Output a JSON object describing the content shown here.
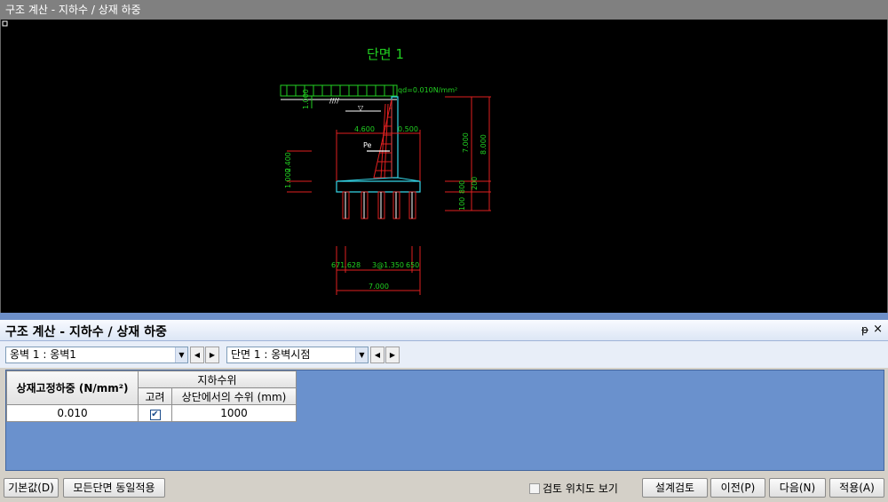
{
  "window": {
    "title": "구조 계산 - 지하수 / 상재 하중"
  },
  "cad": {
    "section_title": "단면 1",
    "load_label": "qd=0.010N/mm²",
    "dims": {
      "top_offset": "1.000",
      "heel": "4.600",
      "stem_top": "0.500",
      "pe_label": "Pe",
      "left_v1": "1.000",
      "left_v2": "2.400",
      "right_v1": "7.000",
      "right_v2": "8.000",
      "right_v3": "200",
      "right_v4": "100",
      "right_v5": "800",
      "bottom_left": "671.628",
      "bottom_mid": "3@1.350",
      "bottom_right": "650",
      "bottom_total": "7.000"
    }
  },
  "panel": {
    "title": "구조 계산 - 지하수 / 상재 하중",
    "pin": "ᵽ",
    "close": "×"
  },
  "selectors": {
    "wall": "옹벽 1 : 옹벽1",
    "section": "단면  1 : 옹벽시점"
  },
  "grid": {
    "col_load": "상재고정하중 (N/mm²)",
    "group_groundwater": "지하수위",
    "col_consider": "고려",
    "col_level": "상단에서의 수위 (mm)",
    "row": {
      "load": "0.010",
      "level": "1000",
      "consider": "✔"
    }
  },
  "bottom": {
    "default_btn": "기본값(D)",
    "apply_all_btn": "모든단면 동일적용",
    "review_position": "검토 위치도 보기",
    "design_review_btn": "설계검토",
    "prev_btn": "이전(P)",
    "next_btn": "다음(N)",
    "apply_btn": "적용(A)"
  },
  "colors": {
    "cad_green": "#22d022",
    "cad_red": "#e02020",
    "cad_cyan": "#35d6e8",
    "panel_blue": "#6a91cd"
  }
}
